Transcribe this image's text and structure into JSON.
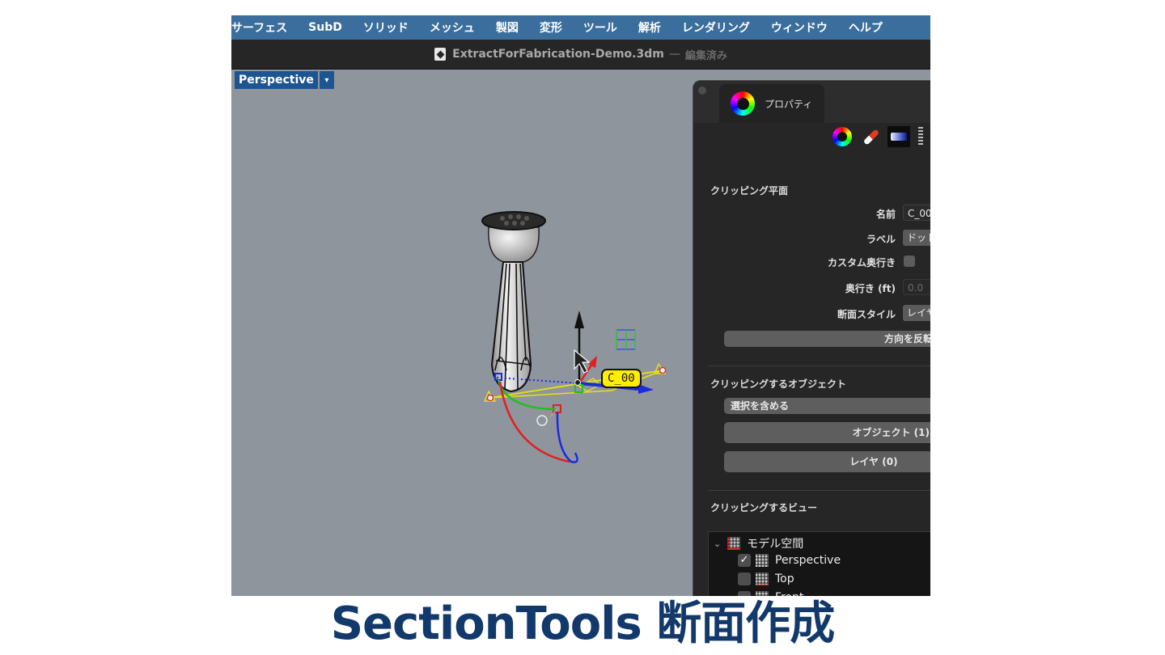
{
  "menubar": {
    "items": [
      "サーフェス",
      "SubD",
      "ソリッド",
      "メッシュ",
      "製図",
      "変形",
      "ツール",
      "解析",
      "レンダリング",
      "ウィンドウ",
      "ヘルプ"
    ]
  },
  "titlebar": {
    "file_name": "ExtractForFabrication-Demo.3dm",
    "separator": "—",
    "state": "編集済み"
  },
  "viewport": {
    "name": "Perspective",
    "dropdown_glyph": "▾",
    "clipping_plane_label": "C_00"
  },
  "panel": {
    "tab_label": "プロパティ",
    "icons": [
      "color-wheel-icon",
      "paint-tube-icon",
      "clipping-plane-icon",
      "more-icon"
    ],
    "clipping_plane": {
      "title": "クリッピング平面",
      "name_label": "名前",
      "name_value": "C_00",
      "label_label": "ラベル",
      "label_value": "ドット",
      "custom_depth_label": "カスタム奥行き",
      "custom_depth_checked": false,
      "depth_label": "奥行き (ft)",
      "depth_value": "0.0",
      "section_style_label": "断面スタイル",
      "section_style_value": "レイヤ",
      "flip_button": "方向を反転"
    },
    "clipping_objects": {
      "title": "クリッピングするオブジェクト",
      "include_selection": "選択を含める",
      "objects_button": "オブジェクト (1)",
      "layers_button": "レイヤ (0)"
    },
    "clipping_views": {
      "title": "クリッピングするビュー",
      "tree_root": "モデル空間",
      "views": [
        {
          "name": "Perspective",
          "checked": true
        },
        {
          "name": "Top",
          "checked": false
        },
        {
          "name": "Front",
          "checked": false
        }
      ]
    }
  },
  "caption": "SectionTools 断面作成",
  "colors": {
    "menubar": "#3b6e9c",
    "viewport_bg": "#8f959c",
    "viewport_tab": "#1d5592",
    "caption": "#12396b",
    "clip_label": "#ffee00"
  }
}
